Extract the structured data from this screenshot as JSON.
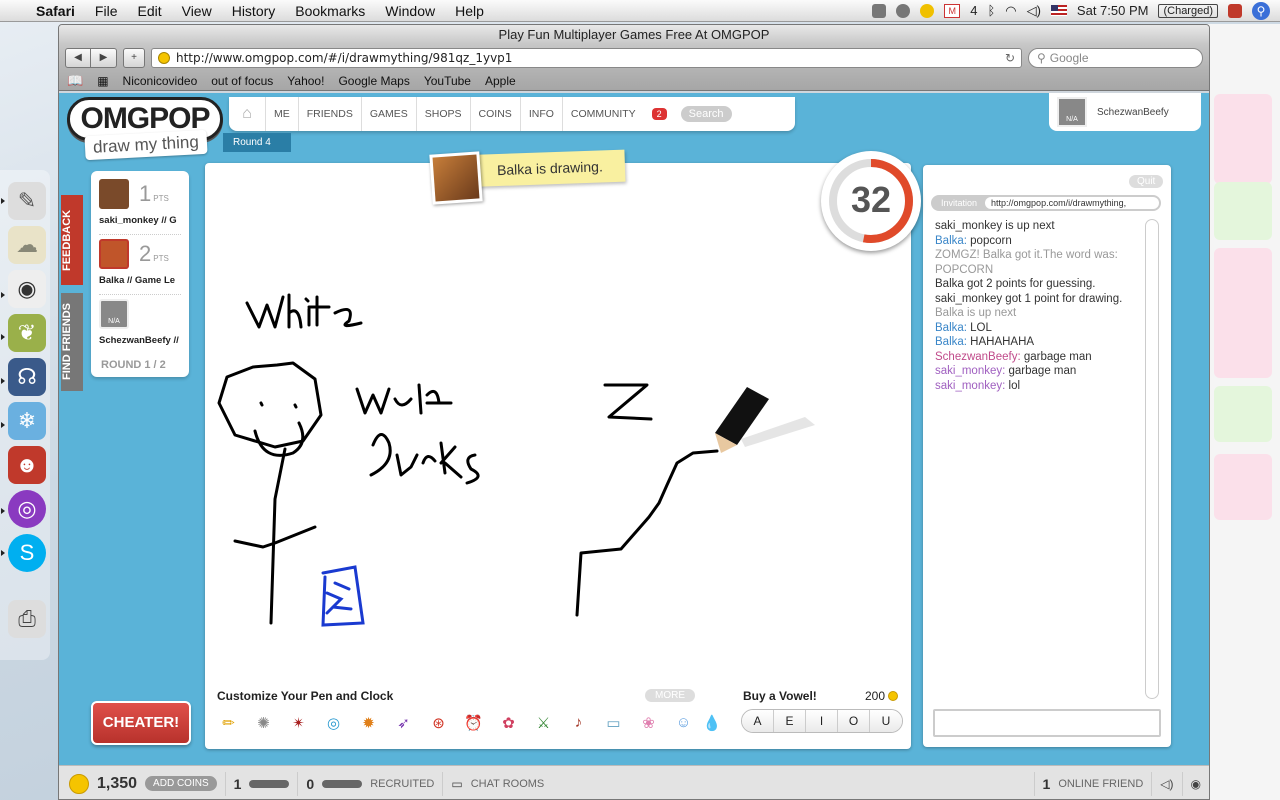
{
  "menubar": {
    "app": "Safari",
    "items": [
      "File",
      "Edit",
      "View",
      "History",
      "Bookmarks",
      "Window",
      "Help"
    ],
    "gmail_count": "4",
    "clock": "Sat 7:50 PM",
    "battery": "(Charged)"
  },
  "window": {
    "title": "Play Fun Multiplayer Games Free At OMGPOP"
  },
  "toolbar": {
    "back": "◀",
    "forward": "▶",
    "add": "+",
    "url": "http://www.omgpop.com/#/i/drawmything/981qz_1yvp1",
    "search_placeholder": "Google"
  },
  "bookmarks": [
    "Niconicovideo",
    "out of focus",
    "Yahoo!",
    "Google Maps",
    "YouTube",
    "Apple"
  ],
  "omgpop": {
    "logo": "OMGPOP",
    "game": "draw my thing",
    "nav": [
      "ME",
      "FRIENDS",
      "GAMES",
      "SHOPS",
      "COINS",
      "INFO",
      "COMMUNITY"
    ],
    "nav_badge": "2",
    "search": "Search",
    "round_tab": "Round 4",
    "username": "SchezwanBeefy",
    "na": "N/A"
  },
  "sidetabs": {
    "feedback": "FEEDBACK",
    "find_friends": "FIND FRIENDS"
  },
  "players": [
    {
      "points": "1",
      "pts_label": "PTS",
      "name": "saki_monkey // G",
      "color": "#7a4a2a"
    },
    {
      "points": "2",
      "pts_label": "PTS",
      "name": "Balka // Game Le",
      "color": "#c0552a"
    },
    {
      "points": "",
      "pts_label": "",
      "name": "SchezwanBeefy //",
      "color": "#888888"
    }
  ],
  "round_label": "ROUND 1 / 2",
  "drawer_note": "Balka is drawing.",
  "timer": {
    "seconds": "32",
    "remaining_fraction": 0.53
  },
  "pens": {
    "label": "Customize Your Pen and Clock",
    "more": "MORE",
    "icons": [
      "pencil-icon",
      "paint-splat-icon",
      "octopus-icon",
      "target-icon",
      "sunflower-icon",
      "rocket-icon",
      "lifesaver-icon",
      "alarm-clock-icon",
      "flower-icon",
      "sword-icon",
      "microphone-icon",
      "bandage-icon",
      "bunny-icon",
      "bunny-face-icon",
      "drop-icon"
    ]
  },
  "vowels": {
    "label": "Buy a Vowel!",
    "cost": "200",
    "letters": [
      "A",
      "E",
      "I",
      "O",
      "U"
    ]
  },
  "cheater": "CHEATER!",
  "chat": {
    "quit": "Quit",
    "invitation": "Invitation",
    "invite_url": "http://omgpop.com/i/drawmything,",
    "lines": [
      {
        "name": "",
        "text": "saki_monkey is up next",
        "color": "#333333"
      },
      {
        "name": "Balka:",
        "text": " popcorn",
        "color": "#3a86c8"
      },
      {
        "name": "",
        "text": "ZOMGZ! Balka got it.The word was: POPCORN",
        "color": "#999999"
      },
      {
        "name": "",
        "text": "Balka got 2 points for guessing.",
        "color": "#333333"
      },
      {
        "name": "",
        "text": "saki_monkey got 1 point for drawing.",
        "color": "#333333"
      },
      {
        "name": "",
        "text": "Balka is up next",
        "color": "#999999"
      },
      {
        "name": "Balka:",
        "text": " LOL",
        "color": "#3a86c8"
      },
      {
        "name": "Balka:",
        "text": " HAHAHAHA",
        "color": "#3a86c8"
      },
      {
        "name": "SchezwanBeefy:",
        "text": " garbage man",
        "color": "#c04a8a"
      },
      {
        "name": "saki_monkey:",
        "text": " garbage man",
        "color": "#a060c0"
      },
      {
        "name": "saki_monkey:",
        "text": " lol",
        "color": "#a060c0"
      }
    ]
  },
  "bottom": {
    "coins": "1,350",
    "add_coins": "ADD COINS",
    "count1": "1",
    "count2": "0",
    "recruited": "RECRUITED",
    "chat_rooms": "CHAT ROOMS",
    "online_count": "1",
    "online_label": "ONLINE FRIEND"
  },
  "drawing": {
    "words": [
      "White",
      "wolf",
      "sucks",
      "z"
    ]
  },
  "colors": {
    "accent": "#5ab3d8",
    "cheater": "#c0392b",
    "timer": "#e04a2a"
  }
}
